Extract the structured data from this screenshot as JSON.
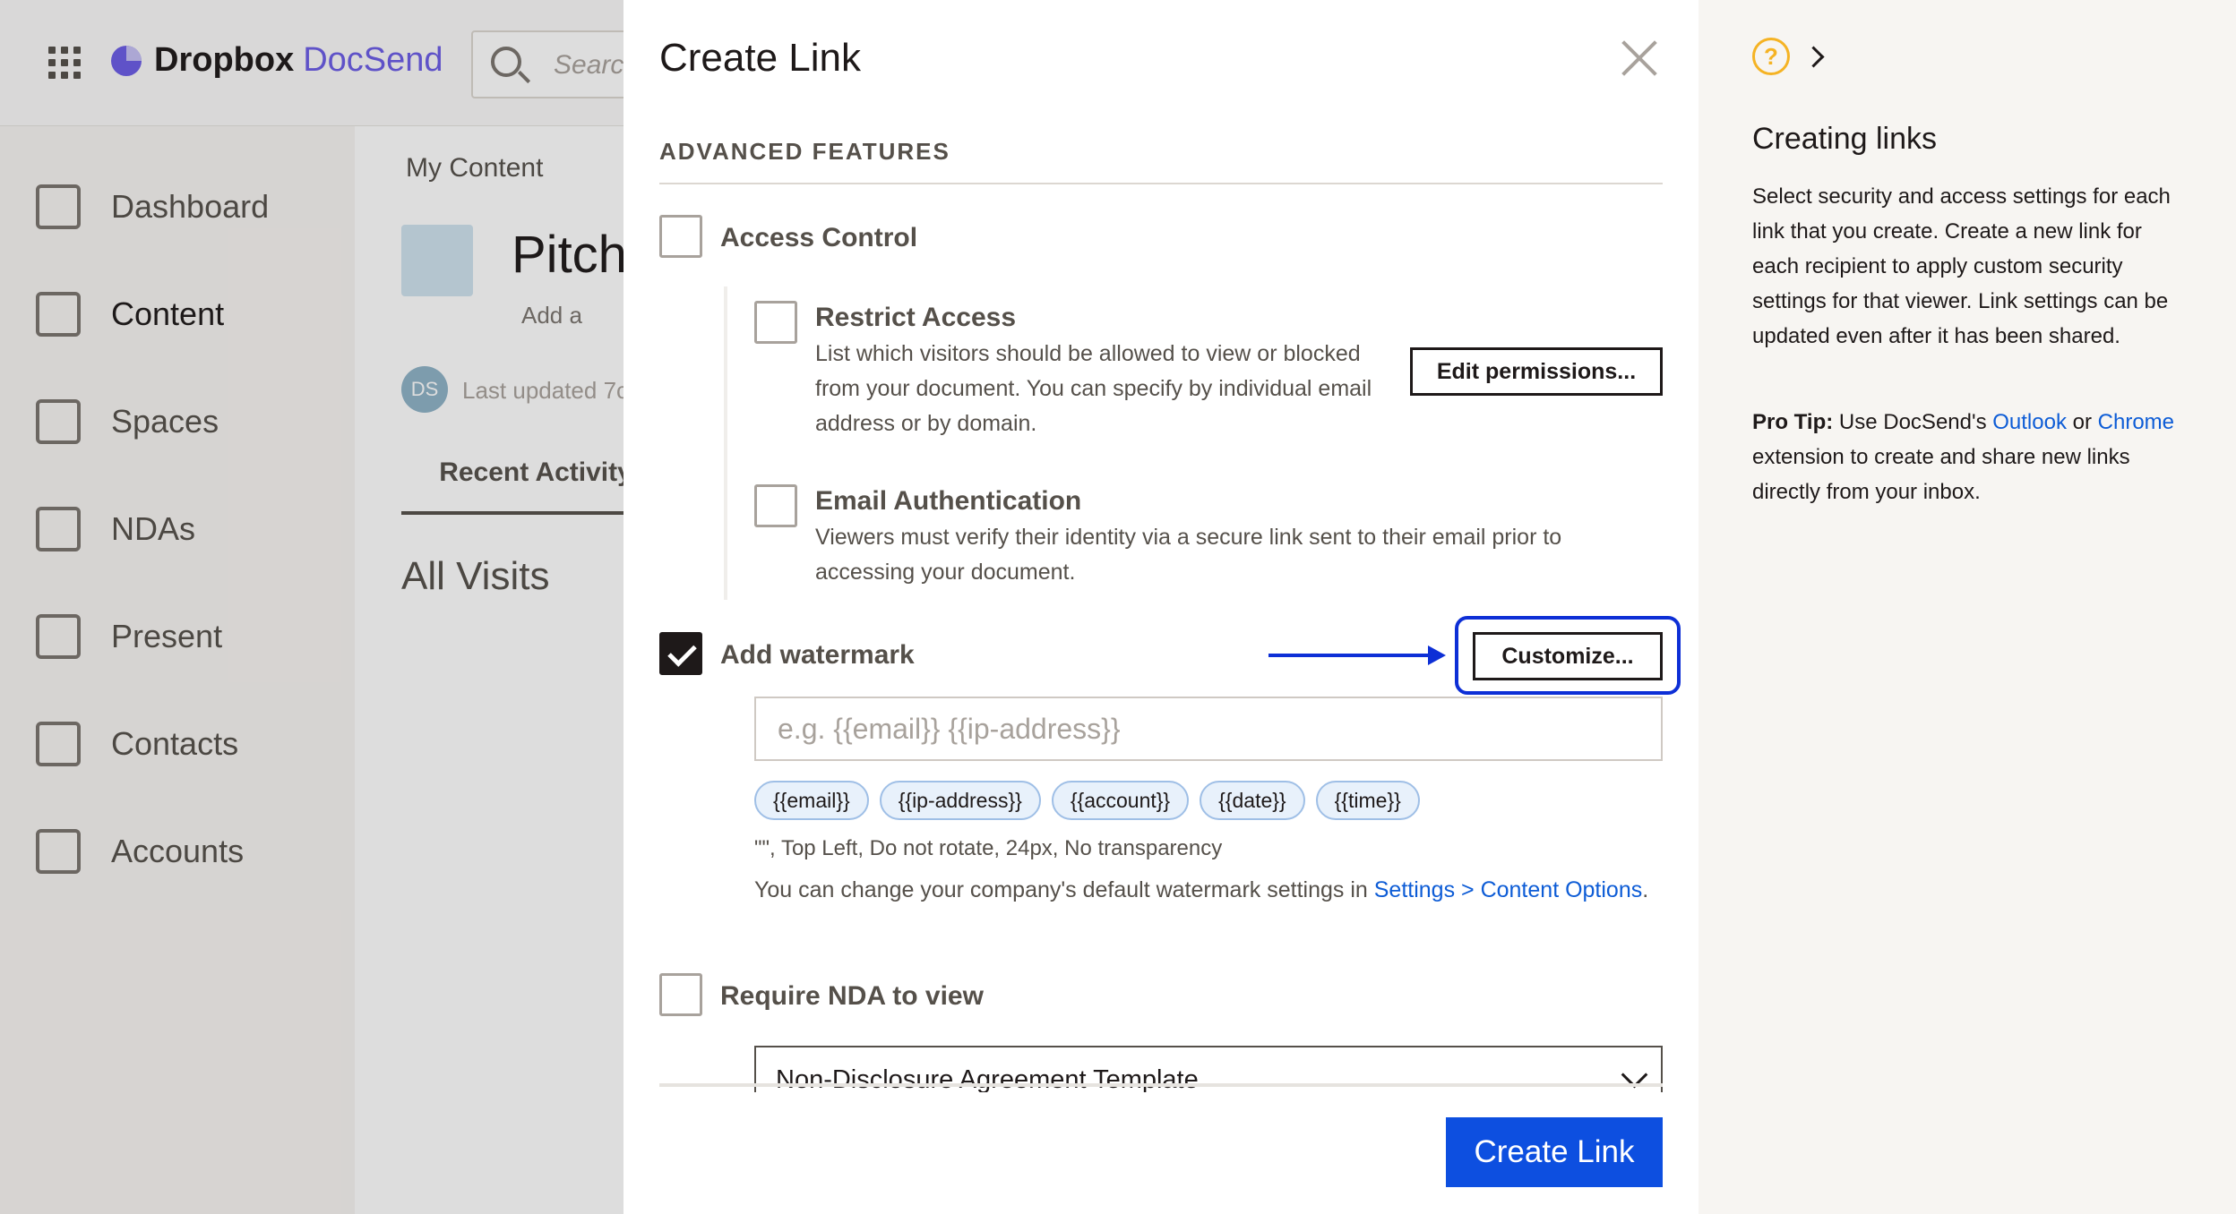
{
  "app": {
    "brand": "Dropbox",
    "brand_product": "DocSend",
    "search_placeholder": "Search"
  },
  "sidebar": {
    "items": [
      {
        "label": "Dashboard",
        "icon": "dashboard-icon"
      },
      {
        "label": "Content",
        "icon": "content-icon"
      },
      {
        "label": "Spaces",
        "icon": "spaces-icon"
      },
      {
        "label": "NDAs",
        "icon": "nda-icon"
      },
      {
        "label": "Present",
        "icon": "present-icon"
      },
      {
        "label": "Contacts",
        "icon": "contacts-icon"
      },
      {
        "label": "Accounts",
        "icon": "accounts-icon"
      }
    ]
  },
  "main": {
    "breadcrumb": "My Content",
    "doc_title": "Pitch",
    "add_desc": "Add a",
    "avatar": "DS",
    "last_updated": "Last updated 7c",
    "tab": "Recent Activity",
    "section": "All Visits"
  },
  "modal": {
    "title": "Create Link",
    "section": "ADVANCED FEATURES",
    "access_control": {
      "label": "Access Control",
      "checked": false
    },
    "restrict_access": {
      "label": "Restrict Access",
      "checked": false,
      "desc": "List which visitors should be allowed to view or blocked from your document. You can specify by individual email address or by domain.",
      "button": "Edit permissions..."
    },
    "email_auth": {
      "label": "Email Authentication",
      "checked": false,
      "desc": "Viewers must verify their identity via a secure link sent to their email prior to accessing your document."
    },
    "watermark": {
      "label": "Add watermark",
      "checked": true,
      "button": "Customize...",
      "placeholder": "e.g. {{email}} {{ip-address}}",
      "tokens": [
        "{{email}}",
        "{{ip-address}}",
        "{{account}}",
        "{{date}}",
        "{{time}}"
      ],
      "summary": "\"\", Top Left, Do not rotate, 24px, No transparency",
      "note_prefix": "You can change your company's default watermark settings in ",
      "note_link": "Settings > Content Options",
      "note_suffix": "."
    },
    "nda": {
      "label": "Require NDA to view",
      "checked": false,
      "selected": "Non-Disclosure Agreement Template"
    },
    "primary_button": "Create Link",
    "colors": {
      "accent": "#0d4fe0",
      "link": "#0d5cd6",
      "highlight": "#0d2fd6"
    }
  },
  "help": {
    "title": "Creating links",
    "icon_glyph": "?",
    "body": "Select security and access settings for each link that you create. Create a new link for each recipient to apply custom security settings for that viewer. Link settings can be updated even after it has been shared.",
    "tip_label": "Pro Tip:",
    "tip_text_1": " Use DocSend's ",
    "tip_link_1": "Outlook",
    "tip_text_2": " or ",
    "tip_link_2": "Chrome",
    "tip_text_3": " extension to create and share new links directly from your inbox."
  }
}
